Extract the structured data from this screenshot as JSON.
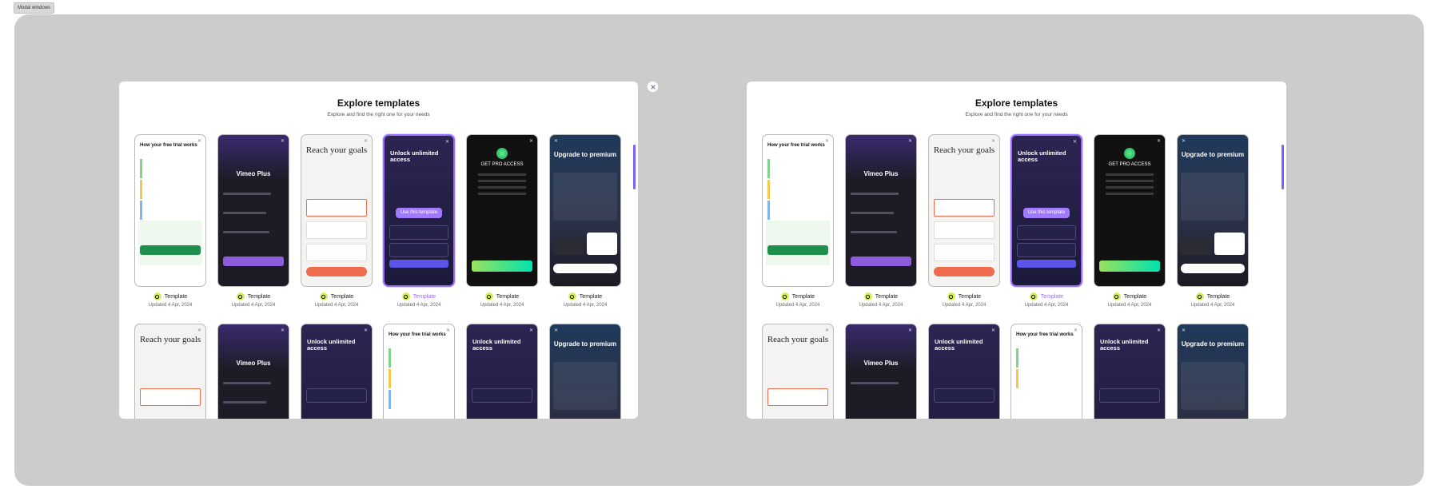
{
  "tab_label": "Modal windows",
  "modal": {
    "title": "Explore templates",
    "subtitle": "Explore and find the right one for your needs",
    "use_template_label": "Use this template"
  },
  "template": {
    "label": "Template",
    "updated": "Updated 4 Apr, 2024"
  },
  "cards": {
    "trial": "How your free trial works",
    "vimeo": "Vimeo Plus",
    "goals": "Reach your goals",
    "unlock": "Unlock unlimited access",
    "pro": "GET PRO ACCESS",
    "premium": "Upgrade to premium"
  },
  "colors": {
    "accent": "#9a6bff",
    "badge": "#d7f05a"
  }
}
